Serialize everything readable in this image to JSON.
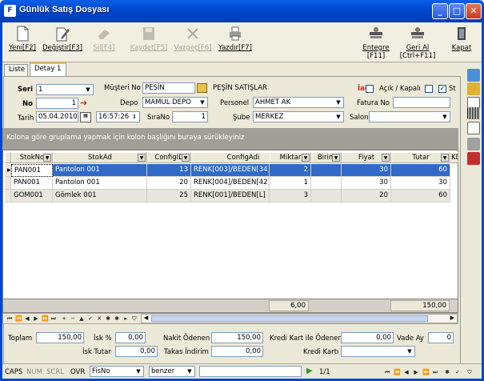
{
  "window": {
    "title": "Günlük Satış Dosyası",
    "icon_text": "F"
  },
  "toolbar": {
    "new": "Yeni[F2]",
    "edit": "Değiştir[F3]",
    "delete": "Sil[F4]",
    "save": "Kaydet[F5]",
    "cancel": "Vazgeç[F6]",
    "print": "Yazdır[F7]",
    "integrate": "Entegre",
    "integrate2": "[F11]",
    "rollback": "Geri Al",
    "rollback2": "[Ctrl+F11]",
    "close": "Kapat"
  },
  "tabs": [
    "Liste",
    "Detay 1"
  ],
  "form": {
    "seri_label": "Seri",
    "seri": "1",
    "no_label": "No",
    "no": "1",
    "tarih_label": "Tarih",
    "tarih": "05.04.2010",
    "saat": "16:57:26",
    "musteri_label": "Müşteri No",
    "musteri": "PESİN",
    "musteri_adi": "PEŞİN SATIŞLAR",
    "depo_label": "Depo",
    "depo": "MAMUL DEPO",
    "sira_label": "SıraNo",
    "sira": "1",
    "personel_label": "Personel",
    "personel": "AHMET AK",
    "sube_label": "Şube",
    "sube": "MERKEZ",
    "iade_label": "İade",
    "acik_label": "Açık / Kapalı",
    "st_label": "St",
    "fatura_label": "Fatura No",
    "fatura": "",
    "salon_label": "Salon",
    "salon": ""
  },
  "group_hint": "Kolona göre gruplama yapmak için kolon başlığını buraya sürükleyiniz",
  "grid": {
    "columns": [
      "StokNo",
      "StokAd",
      "ConfigID",
      "ConfigAdi",
      "Miktar",
      "Birim",
      "Fiyat",
      "Tutar",
      "KD"
    ],
    "rows": [
      [
        "PAN001",
        "Pantolon 001",
        "13",
        "RENK[003]/BEDEN[34]",
        "2",
        "",
        "30",
        "60"
      ],
      [
        "PAN001",
        "Pantolon 001",
        "20",
        "RENK[004]/BEDEN[42]",
        "1",
        "",
        "30",
        "30"
      ],
      [
        "GOM001",
        "Gömlek 001",
        "25",
        "RENK[001]/BEDEN[L]",
        "3",
        "",
        "20",
        "60"
      ]
    ],
    "footer_miktar": "6,00",
    "footer_tutar": "150,00"
  },
  "totals": {
    "toplam_label": "Toplam",
    "toplam": "150,00",
    "isk_label": "İsk %",
    "isk": "0,00",
    "nakit_label": "Nakit Ödenen",
    "nakit": "150,00",
    "kk_label": "Kredi Kart ile Ödenen",
    "kk": "0,00",
    "vade_label": "Vade Ay",
    "vade": "0",
    "isk_tutar_label": "İsk Tutar",
    "isk_tutar": "0,00",
    "takas_label": "Takas İndirim",
    "takas": "0,00",
    "kredi_karti_label": "Kredi Kartı",
    "kredi_karti": ""
  },
  "status": {
    "caps": "CAPS",
    "num": "NUM",
    "scrl": "SCRL",
    "ovr": "OVR",
    "field": "FisNo",
    "mode": "benzer",
    "search": "",
    "page": "1/1"
  }
}
